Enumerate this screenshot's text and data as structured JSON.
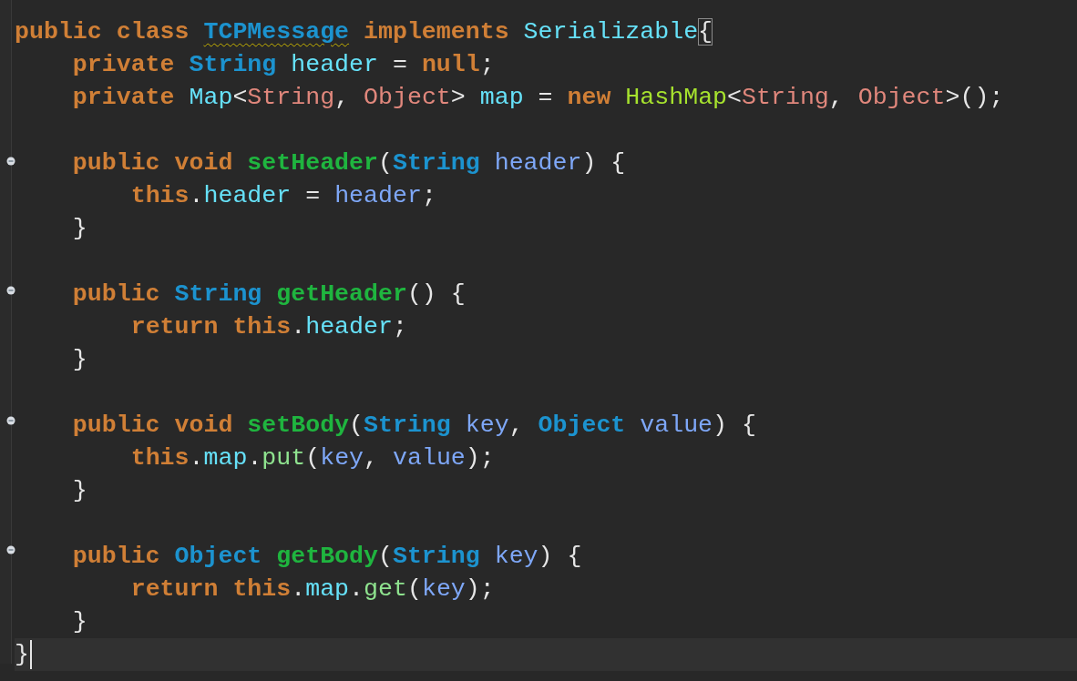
{
  "editor": {
    "lines": [
      {
        "kind": "code",
        "tokens": [
          {
            "text": "public class ",
            "kind": "keyword"
          },
          {
            "text": "TCPMessage",
            "kind": "type",
            "warning": true
          },
          {
            "text": " implements ",
            "kind": "keyword"
          },
          {
            "text": "Serializable",
            "kind": "field"
          },
          {
            "text": "{",
            "kind": "plain",
            "matched": true
          }
        ]
      },
      {
        "kind": "code",
        "tokens": [
          {
            "text": "    private ",
            "kind": "keyword"
          },
          {
            "text": "String ",
            "kind": "type"
          },
          {
            "text": "header",
            "kind": "field"
          },
          {
            "text": " = ",
            "kind": "plain"
          },
          {
            "text": "null",
            "kind": "keyword"
          },
          {
            "text": ";",
            "kind": "plain"
          }
        ]
      },
      {
        "kind": "code",
        "tokens": [
          {
            "text": "    private ",
            "kind": "keyword"
          },
          {
            "text": "Map",
            "kind": "field"
          },
          {
            "text": "<",
            "kind": "plain"
          },
          {
            "text": "String",
            "kind": "generic"
          },
          {
            "text": ", ",
            "kind": "plain"
          },
          {
            "text": "Object",
            "kind": "generic"
          },
          {
            "text": "> ",
            "kind": "plain"
          },
          {
            "text": "map",
            "kind": "field"
          },
          {
            "text": " = ",
            "kind": "plain"
          },
          {
            "text": "new ",
            "kind": "keyword"
          },
          {
            "text": "HashMap",
            "kind": "class"
          },
          {
            "text": "<",
            "kind": "plain"
          },
          {
            "text": "String",
            "kind": "generic"
          },
          {
            "text": ", ",
            "kind": "plain"
          },
          {
            "text": "Object",
            "kind": "generic"
          },
          {
            "text": ">();",
            "kind": "plain"
          }
        ]
      },
      {
        "kind": "blank"
      },
      {
        "kind": "code",
        "collapsed": false,
        "tokens": [
          {
            "text": "    public void ",
            "kind": "keyword"
          },
          {
            "text": "setHeader",
            "kind": "method"
          },
          {
            "text": "(",
            "kind": "plain"
          },
          {
            "text": "String ",
            "kind": "type"
          },
          {
            "text": "header",
            "kind": "param"
          },
          {
            "text": ") {",
            "kind": "plain"
          }
        ]
      },
      {
        "kind": "code",
        "tokens": [
          {
            "text": "        this",
            "kind": "keyword"
          },
          {
            "text": ".",
            "kind": "plain"
          },
          {
            "text": "header",
            "kind": "field"
          },
          {
            "text": " = ",
            "kind": "plain"
          },
          {
            "text": "header",
            "kind": "param"
          },
          {
            "text": ";",
            "kind": "plain"
          }
        ]
      },
      {
        "kind": "code",
        "tokens": [
          {
            "text": "    }",
            "kind": "plain"
          }
        ]
      },
      {
        "kind": "blank"
      },
      {
        "kind": "code",
        "collapsed": false,
        "tokens": [
          {
            "text": "    public ",
            "kind": "keyword"
          },
          {
            "text": "String ",
            "kind": "type"
          },
          {
            "text": "getHeader",
            "kind": "method"
          },
          {
            "text": "() {",
            "kind": "plain"
          }
        ]
      },
      {
        "kind": "code",
        "tokens": [
          {
            "text": "        return this",
            "kind": "keyword"
          },
          {
            "text": ".",
            "kind": "plain"
          },
          {
            "text": "header",
            "kind": "field"
          },
          {
            "text": ";",
            "kind": "plain"
          }
        ]
      },
      {
        "kind": "code",
        "tokens": [
          {
            "text": "    }",
            "kind": "plain"
          }
        ]
      },
      {
        "kind": "blank"
      },
      {
        "kind": "code",
        "collapsed": false,
        "tokens": [
          {
            "text": "    public void ",
            "kind": "keyword"
          },
          {
            "text": "setBody",
            "kind": "method"
          },
          {
            "text": "(",
            "kind": "plain"
          },
          {
            "text": "String ",
            "kind": "type"
          },
          {
            "text": "key",
            "kind": "param"
          },
          {
            "text": ", ",
            "kind": "plain"
          },
          {
            "text": "Object ",
            "kind": "type"
          },
          {
            "text": "value",
            "kind": "param"
          },
          {
            "text": ") {",
            "kind": "plain"
          }
        ]
      },
      {
        "kind": "code",
        "tokens": [
          {
            "text": "        this",
            "kind": "keyword"
          },
          {
            "text": ".",
            "kind": "plain"
          },
          {
            "text": "map",
            "kind": "field"
          },
          {
            "text": ".",
            "kind": "plain"
          },
          {
            "text": "put",
            "kind": "call"
          },
          {
            "text": "(",
            "kind": "plain"
          },
          {
            "text": "key",
            "kind": "param"
          },
          {
            "text": ", ",
            "kind": "plain"
          },
          {
            "text": "value",
            "kind": "param"
          },
          {
            "text": ");",
            "kind": "plain"
          }
        ]
      },
      {
        "kind": "code",
        "tokens": [
          {
            "text": "    }",
            "kind": "plain"
          }
        ]
      },
      {
        "kind": "blank"
      },
      {
        "kind": "code",
        "collapsed": false,
        "tokens": [
          {
            "text": "    public ",
            "kind": "keyword"
          },
          {
            "text": "Object ",
            "kind": "type"
          },
          {
            "text": "getBody",
            "kind": "method"
          },
          {
            "text": "(",
            "kind": "plain"
          },
          {
            "text": "String ",
            "kind": "type"
          },
          {
            "text": "key",
            "kind": "param"
          },
          {
            "text": ") {",
            "kind": "plain"
          }
        ]
      },
      {
        "kind": "code",
        "tokens": [
          {
            "text": "        return this",
            "kind": "keyword"
          },
          {
            "text": ".",
            "kind": "plain"
          },
          {
            "text": "map",
            "kind": "field"
          },
          {
            "text": ".",
            "kind": "plain"
          },
          {
            "text": "get",
            "kind": "call"
          },
          {
            "text": "(",
            "kind": "plain"
          },
          {
            "text": "key",
            "kind": "param"
          },
          {
            "text": ");",
            "kind": "plain"
          }
        ]
      },
      {
        "kind": "code",
        "tokens": [
          {
            "text": "    }",
            "kind": "plain"
          }
        ]
      },
      {
        "kind": "code",
        "current": true,
        "tokens": [
          {
            "text": "}",
            "kind": "plain"
          }
        ]
      }
    ]
  }
}
